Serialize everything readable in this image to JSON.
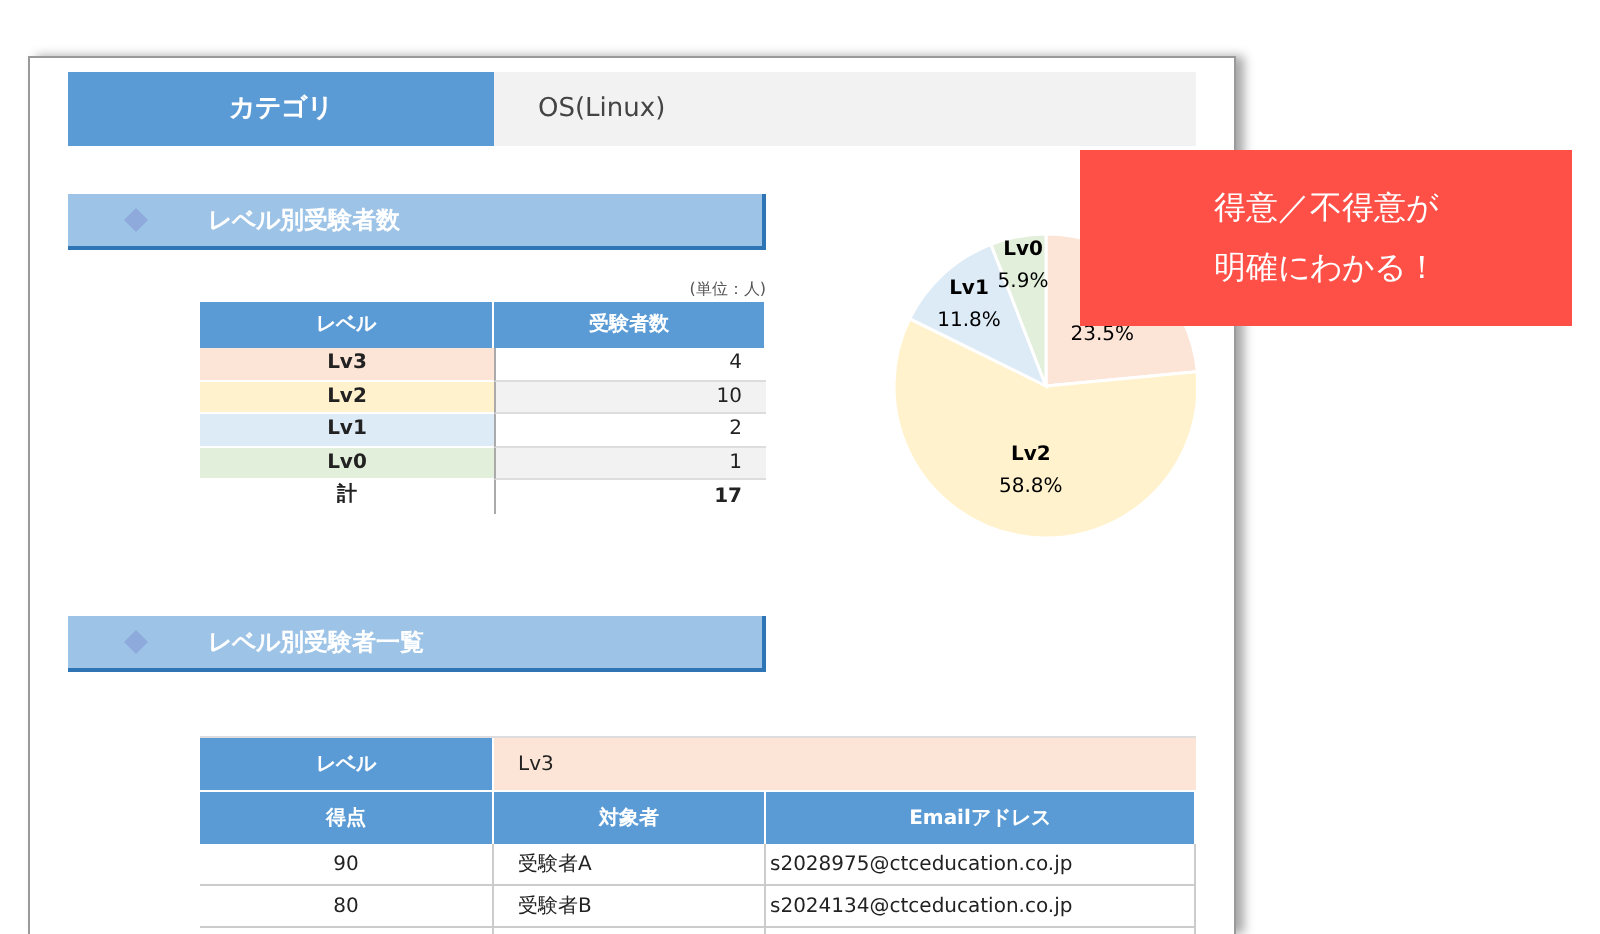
{
  "category": {
    "label": "カテゴリ",
    "value": "OS(Linux)"
  },
  "section_count": {
    "title": "レベル別受験者数",
    "unit": "(単位：人)",
    "columns": [
      "レベル",
      "受験者数"
    ],
    "rows": [
      {
        "level": "Lv3",
        "count": "4",
        "color": "#fce4d6"
      },
      {
        "level": "Lv2",
        "count": "10",
        "color": "#fff2cc"
      },
      {
        "level": "Lv1",
        "count": "2",
        "color": "#ddebf7"
      },
      {
        "level": "Lv0",
        "count": "1",
        "color": "#e2efda"
      }
    ],
    "total": {
      "label": "計",
      "count": "17"
    },
    "chart_data": {
      "type": "pie",
      "categories": [
        null,
        "Lv2",
        "Lv1",
        "Lv0"
      ],
      "values": [
        23.5,
        58.8,
        11.8,
        5.9
      ],
      "value_labels": [
        "23.5%",
        "58.8%",
        "11.8%",
        "5.9%"
      ],
      "colors": [
        "#fce4d6",
        "#fff2cc",
        "#ddebf7",
        "#e2efda"
      ]
    }
  },
  "section_list": {
    "title": "レベル別受験者一覧",
    "level_label": "レベル",
    "level_value": "Lv3",
    "columns": [
      "得点",
      "対象者",
      "Emailアドレス"
    ],
    "rows": [
      [
        "90",
        "受験者A",
        "s2028975@ctceducation.co.jp"
      ],
      [
        "80",
        "受験者B",
        "s2024134@ctceducation.co.jp"
      ]
    ]
  },
  "callout": [
    "得意／不得意が",
    "明確にわかる！"
  ]
}
